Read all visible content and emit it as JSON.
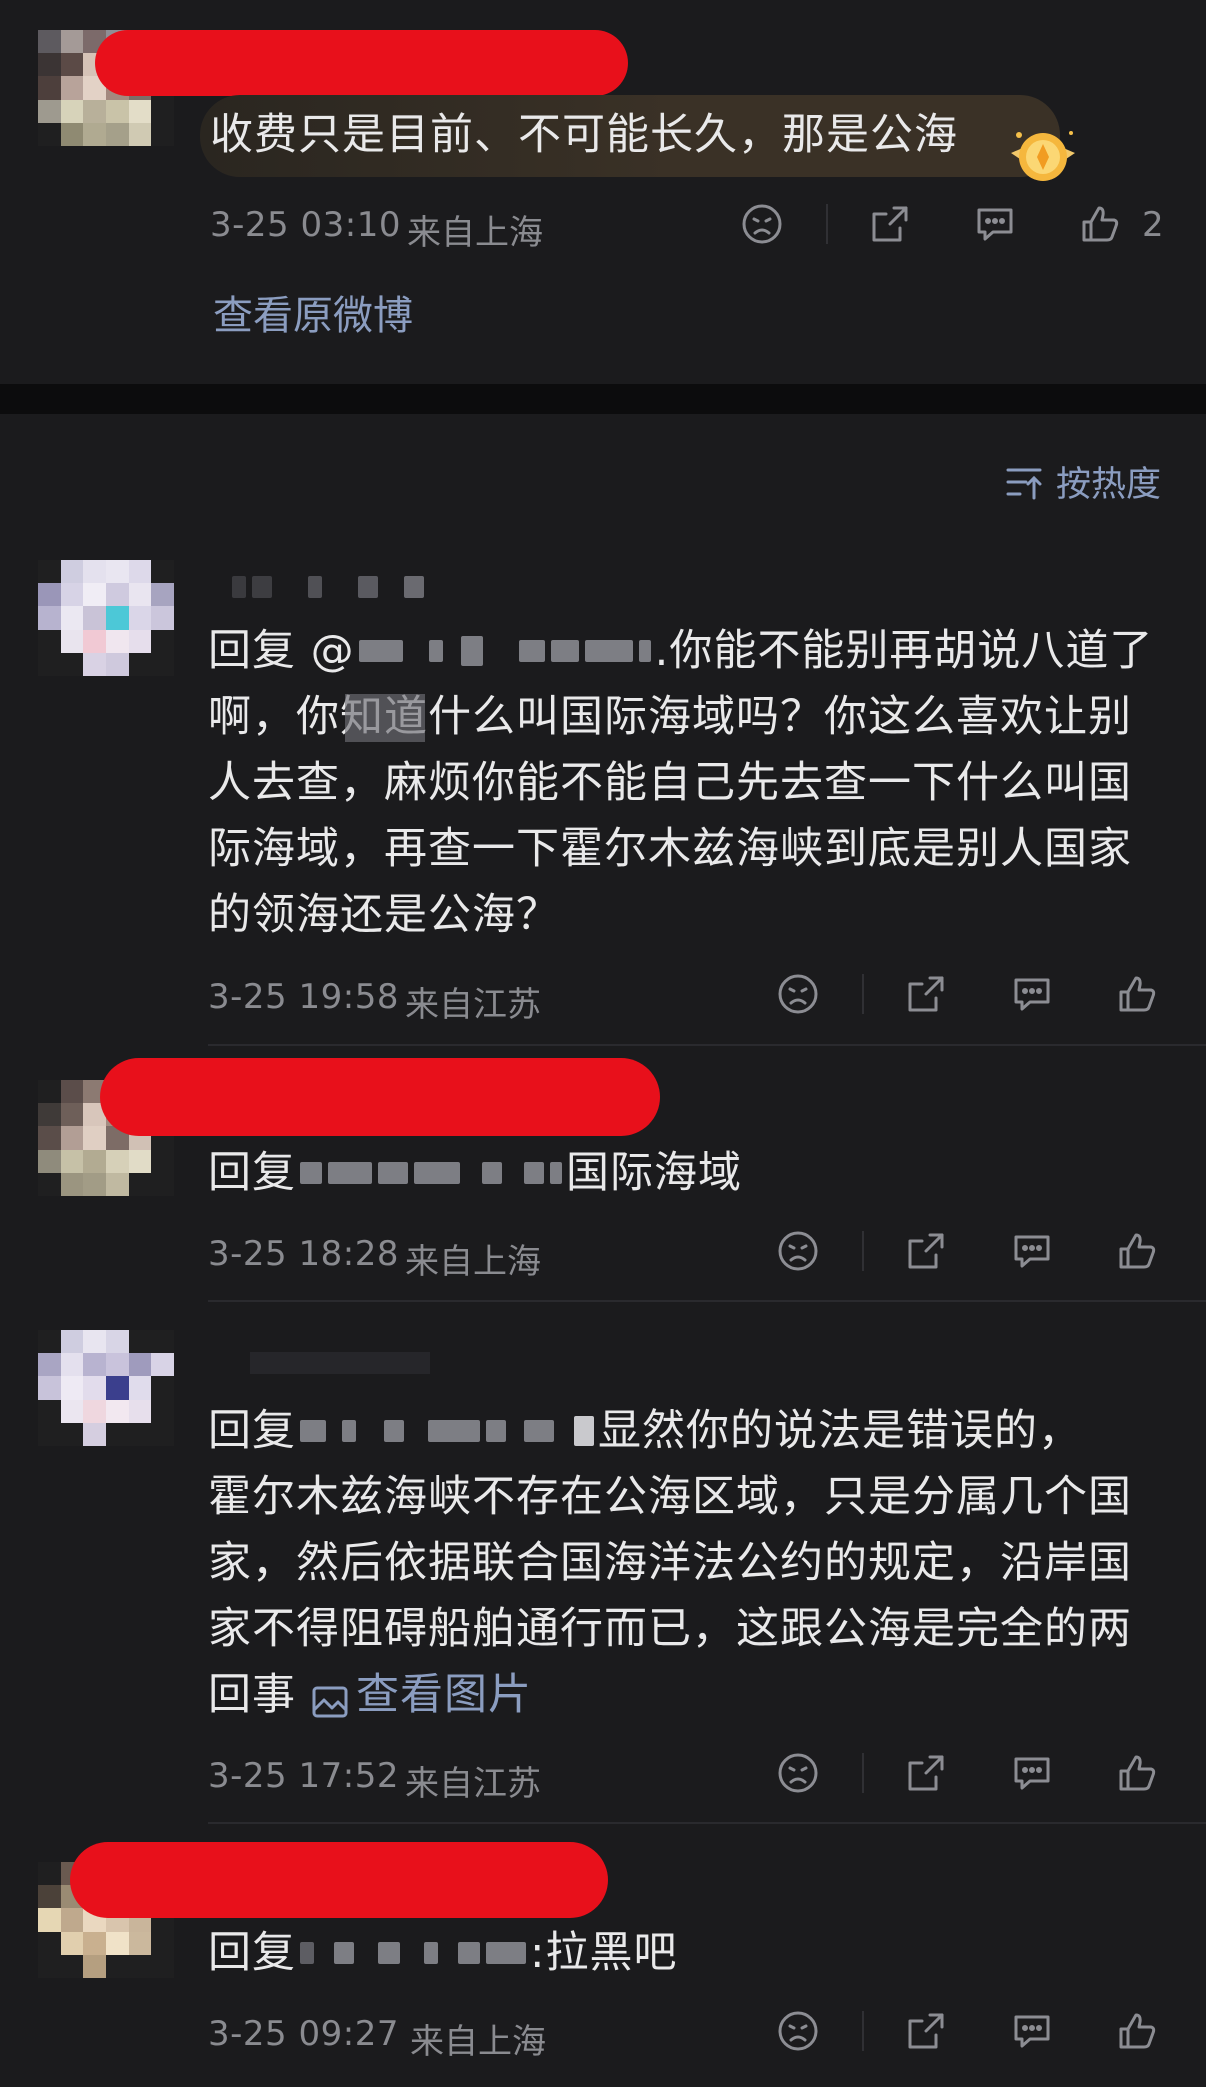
{
  "top_post": {
    "text": "收费只是目前、不可能长久，那是公海",
    "time": "3-25 03:10",
    "location": "来自上海",
    "like_count": "2",
    "view_original": "查看原微博"
  },
  "sort": {
    "label": "按热度"
  },
  "comments": [
    {
      "prefix": "回复 @",
      "first_line_rest": ".你能不能别再胡说八道了",
      "body_lines": [
        "啊，你知道什么叫国际海域吗？你这么喜欢让别",
        "人去查，麻烦你能不能自己先去查一下什么叫国",
        "际海域，再查一下霍尔木兹海峡到底是别人国家",
        "的领海还是公海？"
      ],
      "time": "3-25 19:58",
      "location": "来自江苏"
    },
    {
      "prefix": "回复",
      "first_line_rest": "国际海域",
      "time": "3-25 18:28",
      "location": "来自上海"
    },
    {
      "prefix": "回复",
      "first_line_rest": "显然你的说法是错误的，",
      "body_lines": [
        "霍尔木兹海峡不存在公海区域，只是分属几个国",
        "家，然后依据联合国海洋法公约的规定，沿岸国",
        "家不得阻碍船舶通行而已，这跟公海是完全的两"
      ],
      "last_line": "回事",
      "view_image": "查看图片",
      "time": "3-25 17:52",
      "location": "来自江苏"
    },
    {
      "prefix": "回复",
      "first_line_rest": ":拉黑吧",
      "time": "3-25 09:27",
      "location": "来自上海"
    }
  ],
  "icons": [
    "dislike-icon",
    "share-icon",
    "comment-icon",
    "like-icon",
    "sort-icon",
    "image-icon",
    "badge-icon"
  ],
  "colors": {
    "background": "#1b1b1d",
    "text": "#e9e9ea",
    "meta": "#8a8b90",
    "link": "#8b9dc0",
    "redaction": "#e8101b",
    "badge": "#f2b33d"
  }
}
